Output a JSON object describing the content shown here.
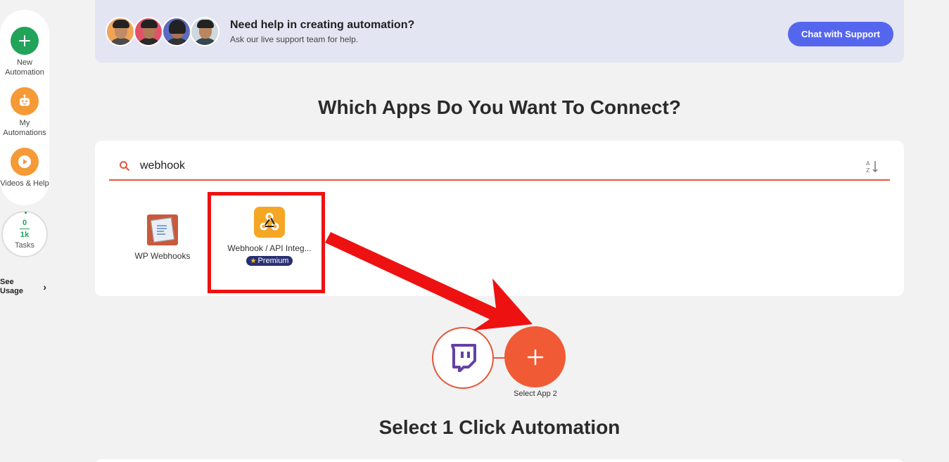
{
  "sidebar": {
    "items": [
      {
        "label": "New Automation",
        "icon": "plus-icon"
      },
      {
        "label": "My Automations",
        "icon": "robot-icon"
      },
      {
        "label": "Videos & Help",
        "icon": "play-icon"
      }
    ],
    "tasks": {
      "used": "0",
      "total": "1k",
      "label": "Tasks"
    },
    "see_usage": "See Usage"
  },
  "banner": {
    "title": "Need help in creating automation?",
    "subtitle": "Ask our live support team for help.",
    "button_label": "Chat with Support"
  },
  "main": {
    "heading": "Which Apps Do You Want To Connect?",
    "search": {
      "value": "webhook"
    },
    "results": [
      {
        "name": "WP Webhooks"
      },
      {
        "name": "Webhook / API Integ...",
        "badge": "Premium"
      }
    ],
    "connector": {
      "select_label": "Select App 2"
    },
    "section_heading": "Select 1 Click Automation"
  },
  "colors": {
    "accent": "#f05a35",
    "primary_button": "#5566ee",
    "highlight": "#ee1111",
    "twitch": "#6441a5"
  }
}
